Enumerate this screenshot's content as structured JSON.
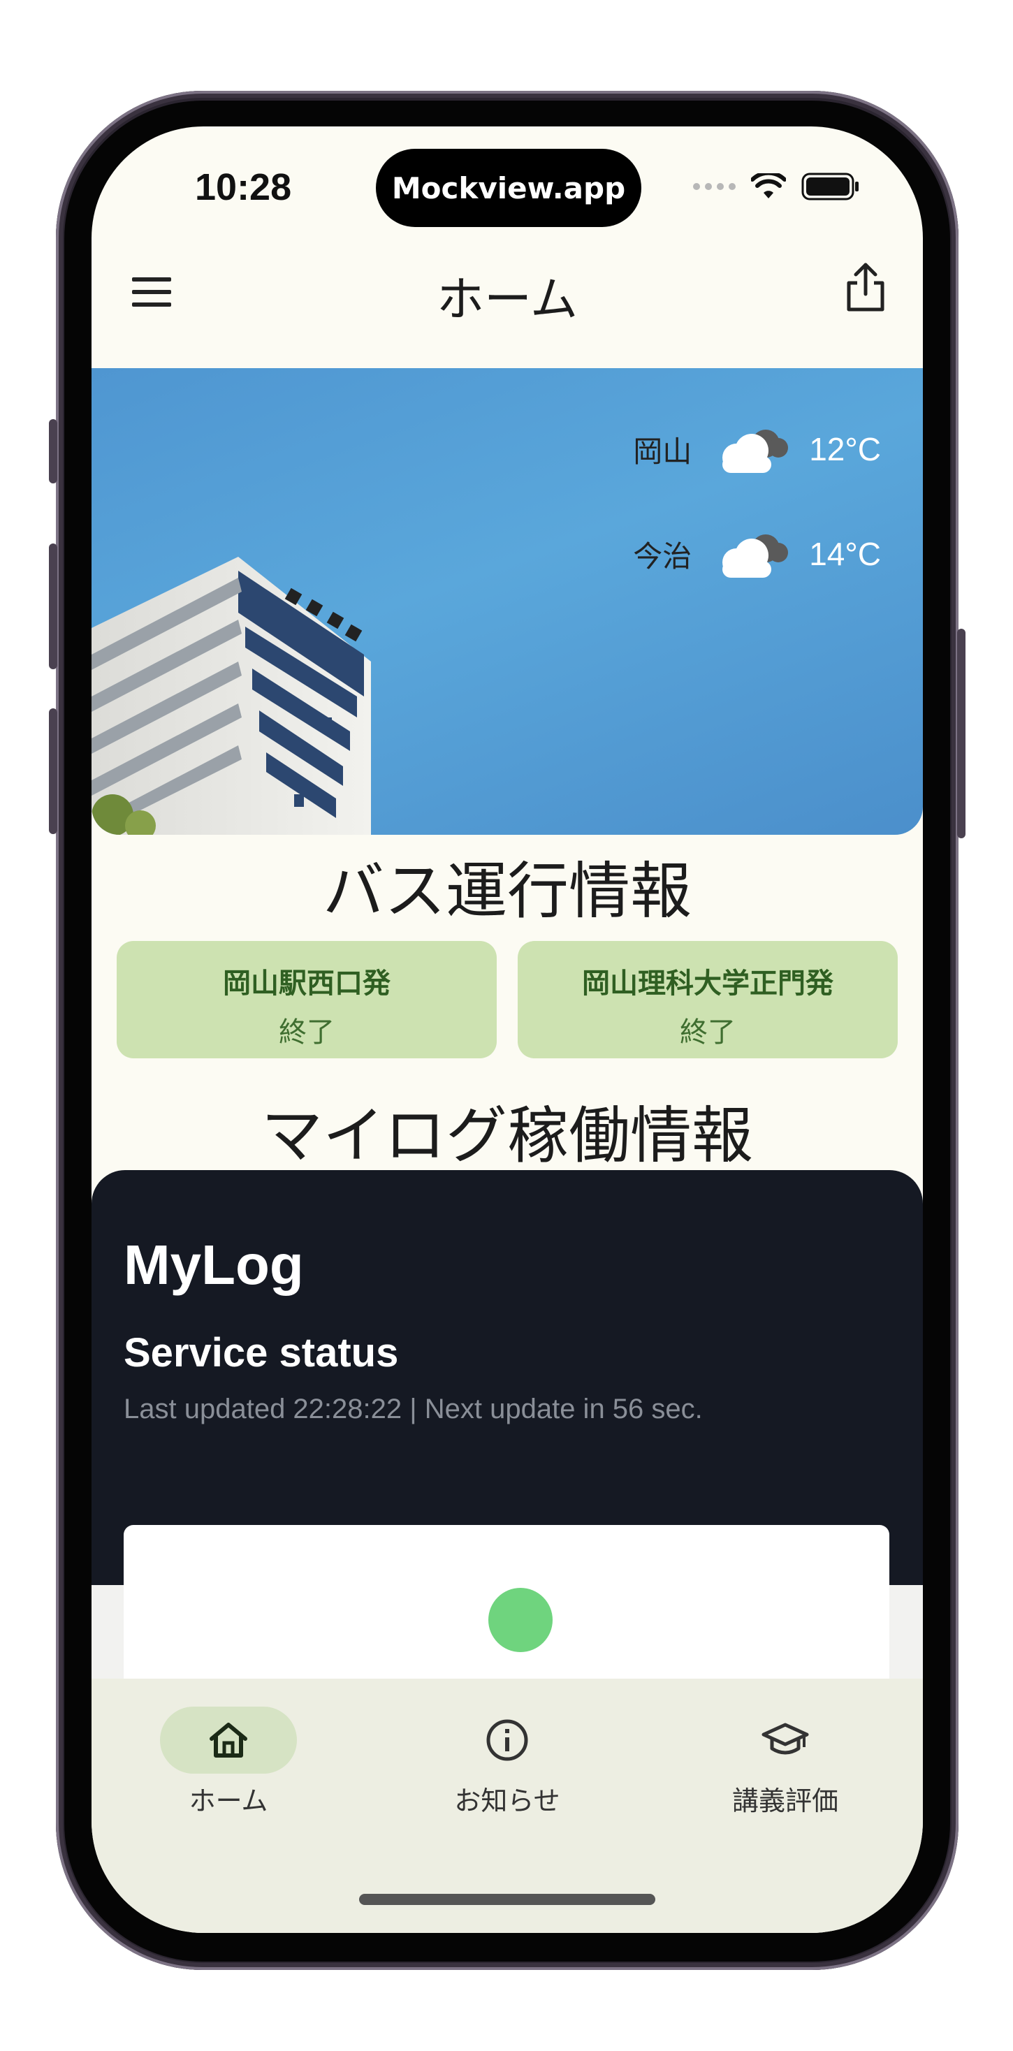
{
  "status_bar": {
    "time": "10:28",
    "island_label": "Mockview.app",
    "icons": [
      "signal-dots-icon",
      "wifi-icon",
      "battery-icon"
    ]
  },
  "app_bar": {
    "title": "ホーム",
    "menu_icon": "hamburger-menu-icon",
    "share_icon": "share-icon"
  },
  "weather": [
    {
      "city": "岡山",
      "icon": "cloudy-icon",
      "temp": "12°C"
    },
    {
      "city": "今治",
      "icon": "cloudy-icon",
      "temp": "14°C"
    }
  ],
  "bus_section": {
    "title": "バス運行情報",
    "cards": [
      {
        "name": "岡山駅西口発",
        "state": "終了"
      },
      {
        "name": "岡山理科大学正門発",
        "state": "終了"
      }
    ]
  },
  "mylog_section": {
    "title": "マイログ稼働情報",
    "card_title": "MyLog",
    "subtitle": "Service status",
    "updated": "Last updated 22:28:22 | Next update in 56 sec.",
    "status_color": "#6fd47e"
  },
  "bottom_nav": {
    "items": [
      {
        "label": "ホーム",
        "icon": "home-icon",
        "active": true
      },
      {
        "label": "お知らせ",
        "icon": "info-icon",
        "active": false
      },
      {
        "label": "講義評価",
        "icon": "graduation-cap-icon",
        "active": false
      }
    ]
  },
  "colors": {
    "accent_green": "#cde2b1",
    "nav_active": "#d6e3c4",
    "dark_panel": "#151923"
  }
}
